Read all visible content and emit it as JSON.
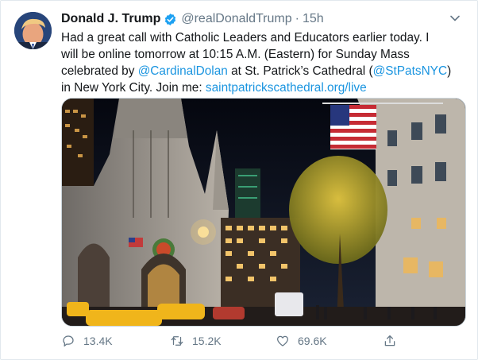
{
  "author": {
    "name": "Donald J. Trump",
    "handle": "@realDonaldTrump",
    "separator": "·",
    "time": "15h"
  },
  "tweet": {
    "line1": "Had a great call with Catholic Leaders and Educators earlier today. I",
    "line2": "will be online tomorrow at 10:15 A.M. (Eastern) for Sunday Mass",
    "line3_pre": "celebrated by ",
    "line3_mention1": "@CardinalDolan",
    "line3_mid": " at St. Patrick’s Cathedral (",
    "line3_mention2": "@StPatsNYC",
    "line3_post": ")",
    "line4_pre": "in New York City. Join me: ",
    "line4_link": "saintpatrickscathedral.org/live"
  },
  "actions": {
    "replies": "13.4K",
    "retweets": "15.2K",
    "likes": "69.6K"
  },
  "icons": {
    "avatar": "avatar-photo",
    "verified": "verified-badge-icon",
    "caret": "chevron-down-icon",
    "reply": "reply-icon",
    "retweet": "retweet-icon",
    "like": "heart-icon",
    "share": "share-icon"
  },
  "colors": {
    "link": "#1b95e0",
    "muted": "#657786",
    "verified": "#1da1f2"
  }
}
